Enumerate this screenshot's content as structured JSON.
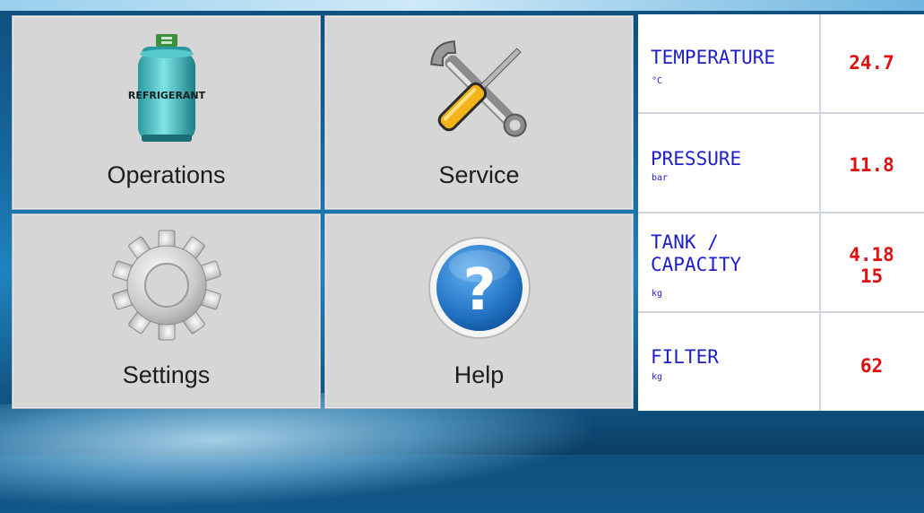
{
  "menu": {
    "operations_label": "Operations",
    "service_label": "Service",
    "settings_label": "Settings",
    "help_label": "Help",
    "refrigerant_tank_text": "REFRIGERANT",
    "help_glyph": "?"
  },
  "readings": {
    "temperature": {
      "label": "TEMPERATURE",
      "unit": "°C",
      "value": "24.7"
    },
    "pressure": {
      "label": "PRESSURE",
      "unit": "bar",
      "value": "11.8"
    },
    "tank_capacity": {
      "label": "TANK /\nCAPACITY",
      "unit": "kg",
      "value": "4.18\n15"
    },
    "filter": {
      "label": "FILTER",
      "unit": "kg",
      "value": "62"
    }
  },
  "colors": {
    "label_blue": "#2020c8",
    "value_red": "#e01010",
    "tile_gray": "#d6d6d6"
  },
  "icons": [
    "refrigerant-tank-icon",
    "wrench-screwdriver-icon",
    "gear-icon",
    "help-icon"
  ]
}
